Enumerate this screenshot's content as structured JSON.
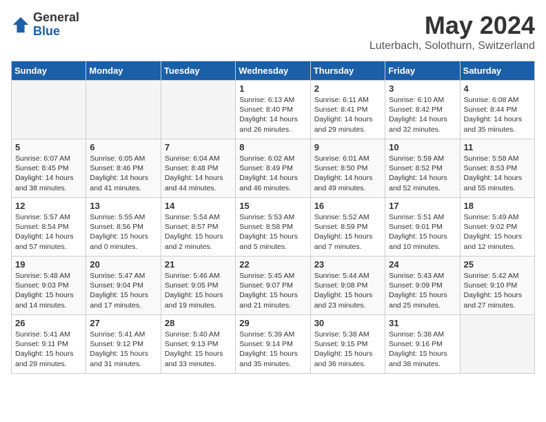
{
  "header": {
    "logo_general": "General",
    "logo_blue": "Blue",
    "month_year": "May 2024",
    "location": "Luterbach, Solothurn, Switzerland"
  },
  "days_of_week": [
    "Sunday",
    "Monday",
    "Tuesday",
    "Wednesday",
    "Thursday",
    "Friday",
    "Saturday"
  ],
  "weeks": [
    [
      {
        "day": "",
        "sunrise": "",
        "sunset": "",
        "daylight": ""
      },
      {
        "day": "",
        "sunrise": "",
        "sunset": "",
        "daylight": ""
      },
      {
        "day": "",
        "sunrise": "",
        "sunset": "",
        "daylight": ""
      },
      {
        "day": "1",
        "sunrise": "Sunrise: 6:13 AM",
        "sunset": "Sunset: 8:40 PM",
        "daylight": "Daylight: 14 hours and 26 minutes."
      },
      {
        "day": "2",
        "sunrise": "Sunrise: 6:11 AM",
        "sunset": "Sunset: 8:41 PM",
        "daylight": "Daylight: 14 hours and 29 minutes."
      },
      {
        "day": "3",
        "sunrise": "Sunrise: 6:10 AM",
        "sunset": "Sunset: 8:42 PM",
        "daylight": "Daylight: 14 hours and 32 minutes."
      },
      {
        "day": "4",
        "sunrise": "Sunrise: 6:08 AM",
        "sunset": "Sunset: 8:44 PM",
        "daylight": "Daylight: 14 hours and 35 minutes."
      }
    ],
    [
      {
        "day": "5",
        "sunrise": "Sunrise: 6:07 AM",
        "sunset": "Sunset: 8:45 PM",
        "daylight": "Daylight: 14 hours and 38 minutes."
      },
      {
        "day": "6",
        "sunrise": "Sunrise: 6:05 AM",
        "sunset": "Sunset: 8:46 PM",
        "daylight": "Daylight: 14 hours and 41 minutes."
      },
      {
        "day": "7",
        "sunrise": "Sunrise: 6:04 AM",
        "sunset": "Sunset: 8:48 PM",
        "daylight": "Daylight: 14 hours and 44 minutes."
      },
      {
        "day": "8",
        "sunrise": "Sunrise: 6:02 AM",
        "sunset": "Sunset: 8:49 PM",
        "daylight": "Daylight: 14 hours and 46 minutes."
      },
      {
        "day": "9",
        "sunrise": "Sunrise: 6:01 AM",
        "sunset": "Sunset: 8:50 PM",
        "daylight": "Daylight: 14 hours and 49 minutes."
      },
      {
        "day": "10",
        "sunrise": "Sunrise: 5:59 AM",
        "sunset": "Sunset: 8:52 PM",
        "daylight": "Daylight: 14 hours and 52 minutes."
      },
      {
        "day": "11",
        "sunrise": "Sunrise: 5:58 AM",
        "sunset": "Sunset: 8:53 PM",
        "daylight": "Daylight: 14 hours and 55 minutes."
      }
    ],
    [
      {
        "day": "12",
        "sunrise": "Sunrise: 5:57 AM",
        "sunset": "Sunset: 8:54 PM",
        "daylight": "Daylight: 14 hours and 57 minutes."
      },
      {
        "day": "13",
        "sunrise": "Sunrise: 5:55 AM",
        "sunset": "Sunset: 8:56 PM",
        "daylight": "Daylight: 15 hours and 0 minutes."
      },
      {
        "day": "14",
        "sunrise": "Sunrise: 5:54 AM",
        "sunset": "Sunset: 8:57 PM",
        "daylight": "Daylight: 15 hours and 2 minutes."
      },
      {
        "day": "15",
        "sunrise": "Sunrise: 5:53 AM",
        "sunset": "Sunset: 8:58 PM",
        "daylight": "Daylight: 15 hours and 5 minutes."
      },
      {
        "day": "16",
        "sunrise": "Sunrise: 5:52 AM",
        "sunset": "Sunset: 8:59 PM",
        "daylight": "Daylight: 15 hours and 7 minutes."
      },
      {
        "day": "17",
        "sunrise": "Sunrise: 5:51 AM",
        "sunset": "Sunset: 9:01 PM",
        "daylight": "Daylight: 15 hours and 10 minutes."
      },
      {
        "day": "18",
        "sunrise": "Sunrise: 5:49 AM",
        "sunset": "Sunset: 9:02 PM",
        "daylight": "Daylight: 15 hours and 12 minutes."
      }
    ],
    [
      {
        "day": "19",
        "sunrise": "Sunrise: 5:48 AM",
        "sunset": "Sunset: 9:03 PM",
        "daylight": "Daylight: 15 hours and 14 minutes."
      },
      {
        "day": "20",
        "sunrise": "Sunrise: 5:47 AM",
        "sunset": "Sunset: 9:04 PM",
        "daylight": "Daylight: 15 hours and 17 minutes."
      },
      {
        "day": "21",
        "sunrise": "Sunrise: 5:46 AM",
        "sunset": "Sunset: 9:05 PM",
        "daylight": "Daylight: 15 hours and 19 minutes."
      },
      {
        "day": "22",
        "sunrise": "Sunrise: 5:45 AM",
        "sunset": "Sunset: 9:07 PM",
        "daylight": "Daylight: 15 hours and 21 minutes."
      },
      {
        "day": "23",
        "sunrise": "Sunrise: 5:44 AM",
        "sunset": "Sunset: 9:08 PM",
        "daylight": "Daylight: 15 hours and 23 minutes."
      },
      {
        "day": "24",
        "sunrise": "Sunrise: 5:43 AM",
        "sunset": "Sunset: 9:09 PM",
        "daylight": "Daylight: 15 hours and 25 minutes."
      },
      {
        "day": "25",
        "sunrise": "Sunrise: 5:42 AM",
        "sunset": "Sunset: 9:10 PM",
        "daylight": "Daylight: 15 hours and 27 minutes."
      }
    ],
    [
      {
        "day": "26",
        "sunrise": "Sunrise: 5:41 AM",
        "sunset": "Sunset: 9:11 PM",
        "daylight": "Daylight: 15 hours and 29 minutes."
      },
      {
        "day": "27",
        "sunrise": "Sunrise: 5:41 AM",
        "sunset": "Sunset: 9:12 PM",
        "daylight": "Daylight: 15 hours and 31 minutes."
      },
      {
        "day": "28",
        "sunrise": "Sunrise: 5:40 AM",
        "sunset": "Sunset: 9:13 PM",
        "daylight": "Daylight: 15 hours and 33 minutes."
      },
      {
        "day": "29",
        "sunrise": "Sunrise: 5:39 AM",
        "sunset": "Sunset: 9:14 PM",
        "daylight": "Daylight: 15 hours and 35 minutes."
      },
      {
        "day": "30",
        "sunrise": "Sunrise: 5:38 AM",
        "sunset": "Sunset: 9:15 PM",
        "daylight": "Daylight: 15 hours and 36 minutes."
      },
      {
        "day": "31",
        "sunrise": "Sunrise: 5:38 AM",
        "sunset": "Sunset: 9:16 PM",
        "daylight": "Daylight: 15 hours and 38 minutes."
      },
      {
        "day": "",
        "sunrise": "",
        "sunset": "",
        "daylight": ""
      }
    ]
  ]
}
